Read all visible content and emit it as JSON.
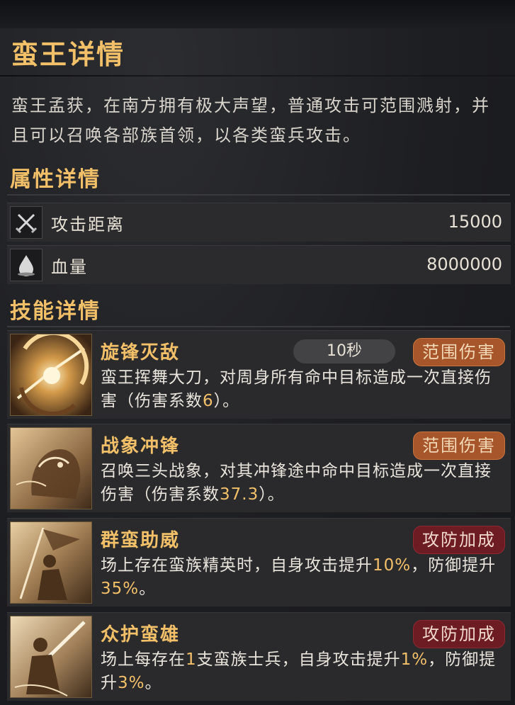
{
  "header": {
    "title": "蛮王详情"
  },
  "description": "蛮王孟获，在南方拥有极大声望，普通攻击可范围溅射，并且可以召唤各部族首领，以各类蛮兵攻击。",
  "attributes": {
    "section_title": "属性详情",
    "items": [
      {
        "label": "攻击距离",
        "value": "15000",
        "icon": "crossed-swords-icon"
      },
      {
        "label": "血量",
        "value": "8000000",
        "icon": "blood-drop-icon"
      }
    ]
  },
  "skills": {
    "section_title": "技能详情",
    "items": [
      {
        "name": "旋锋灭敌",
        "cooldown": "10秒",
        "tag": "范围伤害",
        "tag_color": "#a7562b",
        "desc_a": "蛮王挥舞大刀，对周身所有命中目标造成一次直接伤害（伤害系数",
        "hl1": "6",
        "desc_b": "）。",
        "icon": "spinning-blade-icon"
      },
      {
        "name": "战象冲锋",
        "tag": "范围伤害",
        "tag_color": "#a7562b",
        "desc_a": "召唤三头战象，对其冲锋途中命中目标造成一次直接伤害（伤害系数",
        "hl1": "37.3",
        "desc_b": "）。",
        "icon": "war-elephant-icon"
      },
      {
        "name": "群蛮助威",
        "tag": "攻防加成",
        "tag_color": "#6e1c24",
        "desc_a": "场上存在蛮族精英时，自身攻击提升",
        "hl1": "10%",
        "desc_b": "，防御提升",
        "hl2": "35%",
        "desc_c": "。",
        "icon": "banner-warrior-icon"
      },
      {
        "name": "众护蛮雄",
        "tag": "攻防加成",
        "tag_color": "#6e1c24",
        "desc_a": "场上每存在",
        "hl0": "1",
        "desc_a2": "支蛮族士兵，自身攻击提升",
        "hl1": "1%",
        "desc_b": "，防御提升",
        "hl2": "3%",
        "desc_c": "。",
        "icon": "sword-warrior-icon"
      }
    ]
  }
}
